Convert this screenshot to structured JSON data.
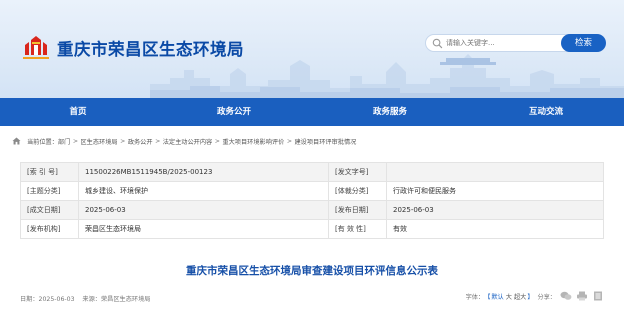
{
  "header": {
    "title": "重庆市荣昌区生态环境局"
  },
  "search": {
    "placeholder": "请输入关键字...",
    "button_label": "检索"
  },
  "nav": {
    "items": [
      "首页",
      "政务公开",
      "政务服务",
      "互动交流"
    ]
  },
  "breadcrumb": {
    "items": [
      "当前位置：部门",
      "区生态环境局",
      "政务公开",
      "法定主动公开内容",
      "重大项目环境影响评价",
      "建设项目环评审批情况"
    ],
    "separator": ">"
  },
  "info": {
    "rows": [
      {
        "label1": "[索 引 号]",
        "value1": "11500226MB1511945B/2025-00123",
        "label2": "[发文字号]",
        "value2": ""
      },
      {
        "label1": "[主题分类]",
        "value1": "城乡建设、环境保护",
        "label2": "[体裁分类]",
        "value2": "行政许可和便民服务"
      },
      {
        "label1": "[成文日期]",
        "value1": "2025-06-03",
        "label2": "[发布日期]",
        "value2": "2025-06-03"
      },
      {
        "label1": "[发布机构]",
        "value1": "荣昌区生态环境局",
        "label2": "[有 效 性]",
        "value2": "有效"
      }
    ]
  },
  "article": {
    "title": "重庆市荣昌区生态环境局审查建设项目环评信息公示表"
  },
  "meta": {
    "date_label": "日期：2025-06-03",
    "source_label": "来源：荣昌区生态环境局",
    "font_label": "字体：",
    "bracket_open": "【",
    "bracket_close": "】",
    "font_sizes": [
      "默认",
      "大",
      "超大"
    ],
    "share_label": "分享："
  },
  "colors": {
    "brand_blue": "#1a5fbf",
    "title_blue": "#0b4aa6",
    "logo_red": "#d9261c"
  }
}
